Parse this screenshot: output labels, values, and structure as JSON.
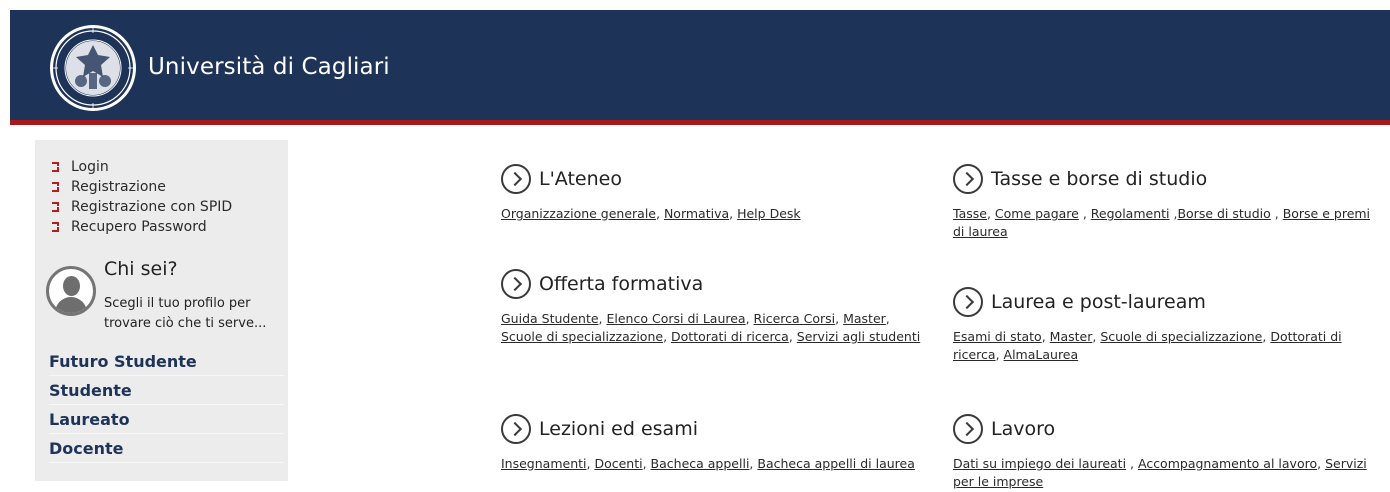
{
  "header": {
    "title": "Università di Cagliari",
    "logo_icon": "university-seal-icon",
    "colors": {
      "background": "#1e3358",
      "stripe": "#a8181c"
    }
  },
  "sidebar": {
    "login_links": [
      {
        "label": "Login"
      },
      {
        "label": "Registrazione"
      },
      {
        "label": "Registrazione con SPID"
      },
      {
        "label": "Recupero Password"
      }
    ],
    "chisei": {
      "title": "Chi sei?",
      "text": "Scegli il tuo profilo per trovare ciò che ti serve..."
    },
    "profiles": [
      {
        "label": "Futuro Studente"
      },
      {
        "label": "Studente"
      },
      {
        "label": "Laureato"
      },
      {
        "label": "Docente"
      }
    ]
  },
  "sections": {
    "ateneo": {
      "title": "L'Ateneo",
      "links": [
        {
          "label": "Organizzazione generale",
          "sep": ", "
        },
        {
          "label": "Normativa",
          "sep": ", "
        },
        {
          "label": "Help Desk",
          "sep": ""
        }
      ]
    },
    "offerta": {
      "title": "Offerta formativa",
      "links": [
        {
          "label": "Guida Studente",
          "sep": ", "
        },
        {
          "label": "Elenco Corsi di Laurea",
          "sep": ", "
        },
        {
          "label": "Ricerca Corsi",
          "sep": ", "
        },
        {
          "label": "Master",
          "sep": ", "
        },
        {
          "label": "Scuole di specializzazione",
          "sep": ", "
        },
        {
          "label": "Dottorati di ricerca",
          "sep": ", "
        },
        {
          "label": "Servizi agli studenti",
          "sep": ""
        }
      ]
    },
    "lezioni": {
      "title": "Lezioni ed esami",
      "links": [
        {
          "label": "Insegnamenti",
          "sep": ", "
        },
        {
          "label": "Docenti",
          "sep": ", "
        },
        {
          "label": "Bacheca appelli",
          "sep": ", "
        },
        {
          "label": "Bacheca appelli di laurea",
          "sep": ""
        }
      ]
    },
    "tasse": {
      "title": "Tasse e borse di studio",
      "links": [
        {
          "label": "Tasse",
          "sep": ", "
        },
        {
          "label": "Come pagare",
          "sep": " , "
        },
        {
          "label": "Regolamenti",
          "sep": " ,"
        },
        {
          "label": "Borse di studio",
          "sep": " , "
        },
        {
          "label": "Borse e premi di laurea",
          "sep": ""
        }
      ]
    },
    "laurea": {
      "title": "Laurea e post-lauream",
      "links": [
        {
          "label": "Esami di stato",
          "sep": ", "
        },
        {
          "label": "Master",
          "sep": ", "
        },
        {
          "label": "Scuole di specializzazione",
          "sep": ", "
        },
        {
          "label": "Dottorati di ricerca",
          "sep": ", "
        },
        {
          "label": "AlmaLaurea",
          "sep": ""
        }
      ]
    },
    "lavoro": {
      "title": "Lavoro",
      "links": [
        {
          "label": "Dati su impiego dei laureati",
          "sep": " , "
        },
        {
          "label": "Accompagnamento al lavoro",
          "sep": ", "
        },
        {
          "label": "Servizi per le imprese",
          "sep": ""
        }
      ]
    }
  }
}
